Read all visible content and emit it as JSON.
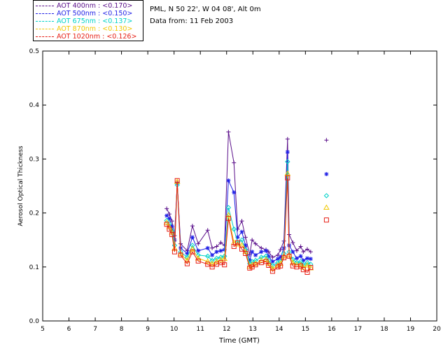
{
  "header": {
    "site_line": "PML, N 50 22', W 04 08', Alt 0m",
    "date_line": "Data from: 11 Feb 2003"
  },
  "legend": [
    {
      "label": "AOT  400nm : <0.170>",
      "color": "#5a0f8a"
    },
    {
      "label": "AOT  500nm : <0.150>",
      "color": "#1e1ee6"
    },
    {
      "label": "AOT  675nm : <0.137>",
      "color": "#00d2c8"
    },
    {
      "label": "AOT  870nm : <0.130>",
      "color": "#f0c800"
    },
    {
      "label": "AOT 1020nm : <0.126>",
      "color": "#e61e14"
    }
  ],
  "chart_data": {
    "type": "line",
    "title": "",
    "xlabel": "Time (GMT)",
    "ylabel": "Aerosol Optical Thickness",
    "xlim": [
      5,
      20
    ],
    "ylim": [
      0.0,
      0.5
    ],
    "x_ticks": [
      "5",
      "6",
      "7",
      "8",
      "9",
      "10",
      "11",
      "12",
      "13",
      "14",
      "15",
      "16",
      "17",
      "18",
      "19",
      "20"
    ],
    "y_ticks": [
      "0.0",
      "0.1",
      "0.2",
      "0.3",
      "0.4",
      "0.5"
    ],
    "grid": false,
    "legend_position": "top-left, outside plot",
    "x": [
      9.72,
      9.82,
      9.92,
      10.02,
      10.12,
      10.25,
      10.5,
      10.7,
      10.92,
      11.28,
      11.45,
      11.62,
      11.78,
      11.92,
      12.07,
      12.28,
      12.42,
      12.58,
      12.72,
      12.88,
      12.97,
      13.1,
      13.32,
      13.5,
      13.6,
      13.75,
      13.95,
      14.05,
      14.18,
      14.32,
      14.38,
      14.52,
      14.67,
      14.82,
      14.92,
      15.07,
      15.2
    ],
    "series": [
      {
        "name": "AOT  400nm : <0.170>",
        "marker": "+",
        "color": "#5a0f8a",
        "values": [
          0.208,
          0.198,
          0.185,
          0.158,
          0.255,
          0.143,
          0.13,
          0.176,
          0.143,
          0.168,
          0.135,
          0.138,
          0.145,
          0.14,
          0.35,
          0.293,
          0.17,
          0.185,
          0.155,
          0.123,
          0.15,
          0.143,
          0.135,
          0.132,
          0.128,
          0.118,
          0.122,
          0.132,
          0.148,
          0.337,
          0.16,
          0.145,
          0.13,
          0.138,
          0.128,
          0.133,
          0.128
        ],
        "extra_point": {
          "x": 15.8,
          "y": 0.335
        }
      },
      {
        "name": "AOT  500nm : <0.150>",
        "marker": "*",
        "color": "#1e1ee6",
        "values": [
          0.195,
          0.19,
          0.175,
          0.15,
          0.255,
          0.135,
          0.125,
          0.155,
          0.13,
          0.135,
          0.122,
          0.128,
          0.13,
          0.132,
          0.26,
          0.238,
          0.155,
          0.165,
          0.14,
          0.112,
          0.128,
          0.122,
          0.128,
          0.13,
          0.12,
          0.11,
          0.115,
          0.118,
          0.135,
          0.313,
          0.14,
          0.128,
          0.116,
          0.12,
          0.112,
          0.116,
          0.115
        ],
        "extra_point": {
          "x": 15.8,
          "y": 0.272
        }
      },
      {
        "name": "AOT  675nm : <0.137>",
        "marker": "diamond",
        "color": "#00d2c8",
        "values": [
          0.186,
          0.18,
          0.168,
          0.14,
          0.252,
          0.128,
          0.118,
          0.14,
          0.122,
          0.12,
          0.112,
          0.116,
          0.118,
          0.12,
          0.21,
          0.17,
          0.145,
          0.15,
          0.132,
          0.106,
          0.11,
          0.112,
          0.118,
          0.12,
          0.112,
          0.103,
          0.108,
          0.11,
          0.125,
          0.295,
          0.128,
          0.114,
          0.108,
          0.11,
          0.104,
          0.108,
          0.105
        ],
        "extra_point": {
          "x": 15.8,
          "y": 0.232
        }
      },
      {
        "name": "AOT  870nm : <0.130>",
        "marker": "triangle",
        "color": "#f0c800",
        "values": [
          0.182,
          0.174,
          0.164,
          0.134,
          0.258,
          0.124,
          0.112,
          0.133,
          0.116,
          0.11,
          0.106,
          0.11,
          0.113,
          0.115,
          0.196,
          0.145,
          0.142,
          0.14,
          0.128,
          0.101,
          0.104,
          0.106,
          0.112,
          0.114,
          0.106,
          0.097,
          0.103,
          0.106,
          0.12,
          0.273,
          0.122,
          0.108,
          0.104,
          0.104,
          0.099,
          0.103,
          0.098
        ],
        "extra_point": {
          "x": 15.8,
          "y": 0.21
        }
      },
      {
        "name": "AOT 1020nm : <0.126>",
        "marker": "square",
        "color": "#e61e14",
        "values": [
          0.179,
          0.17,
          0.16,
          0.128,
          0.26,
          0.122,
          0.106,
          0.128,
          0.111,
          0.105,
          0.1,
          0.105,
          0.108,
          0.104,
          0.19,
          0.138,
          0.145,
          0.133,
          0.125,
          0.098,
          0.1,
          0.104,
          0.108,
          0.11,
          0.103,
          0.092,
          0.1,
          0.102,
          0.117,
          0.265,
          0.12,
          0.102,
          0.1,
          0.102,
          0.095,
          0.09,
          0.099
        ],
        "extra_point": {
          "x": 15.8,
          "y": 0.187
        }
      }
    ]
  }
}
